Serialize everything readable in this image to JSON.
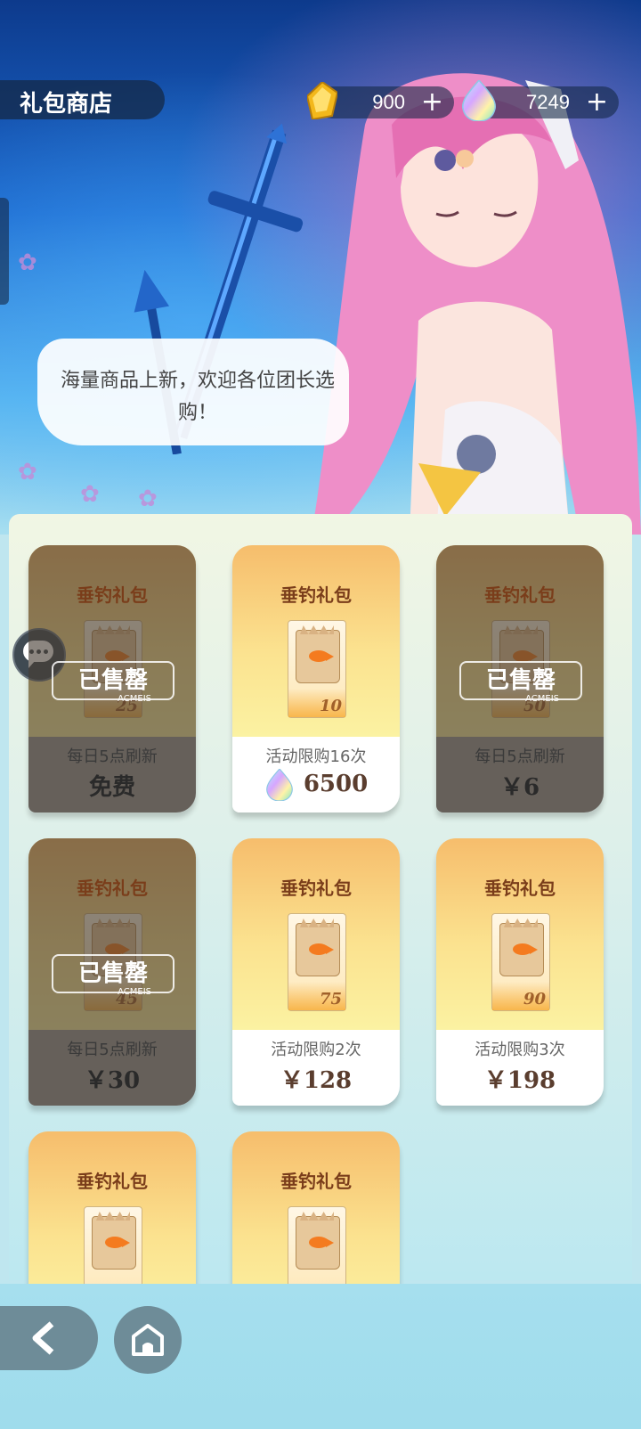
{
  "header": {
    "title": "礼包商店",
    "gold_amount": "900",
    "gem_amount": "7249",
    "plus": "+"
  },
  "hero": {
    "dialog": "海量商品上新，欢迎各位团长选购！"
  },
  "sold_label": "已售罄",
  "watermark": "ACMEIS",
  "cards": [
    {
      "name": "垂钓礼包",
      "qty": "25",
      "limit": "每日5点刷新",
      "price": "免费",
      "sold": true
    },
    {
      "name": "垂钓礼包",
      "qty": "10",
      "limit": "活动限购16次",
      "price": "6500",
      "sold": false,
      "currency": "gem"
    },
    {
      "name": "垂钓礼包",
      "qty": "50",
      "limit": "每日5点刷新",
      "price": "￥6",
      "sold": true
    },
    {
      "name": "垂钓礼包",
      "qty": "45",
      "limit": "每日5点刷新",
      "price": "￥30",
      "sold": true
    },
    {
      "name": "垂钓礼包",
      "qty": "75",
      "limit": "活动限购2次",
      "price": "￥128",
      "sold": false
    },
    {
      "name": "垂钓礼包",
      "qty": "90",
      "limit": "活动限购3次",
      "price": "￥198",
      "sold": false
    },
    {
      "name": "垂钓礼包"
    },
    {
      "name": "垂钓礼包"
    }
  ],
  "colors": {
    "accent_gold": "#f6bd6c",
    "price_text": "#5a3d2e",
    "nav_button": "#6e8c98"
  },
  "icons": [
    "gold-crystal-icon",
    "rainbow-gem-icon",
    "plus-icon",
    "chat-icon",
    "back-arrow-icon",
    "home-icon",
    "bait-bag-icon"
  ]
}
